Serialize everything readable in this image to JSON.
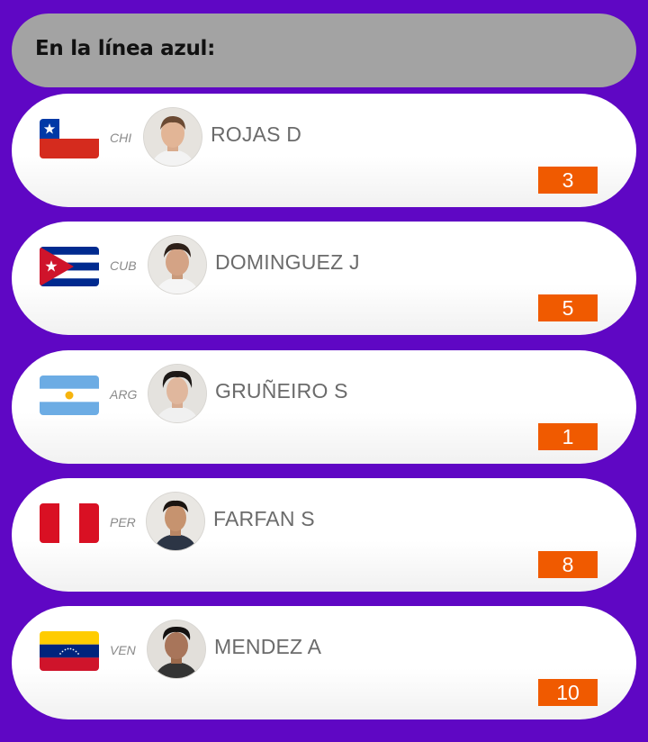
{
  "header": {
    "title": "En la línea azul:"
  },
  "players": [
    {
      "code": "CHI",
      "name": "ROJAS D",
      "score": "3",
      "flag": "chile-flag-icon"
    },
    {
      "code": "CUB",
      "name": "DOMINGUEZ J",
      "score": "5",
      "flag": "cuba-flag-icon"
    },
    {
      "code": "ARG",
      "name": "GRUÑEIRO S",
      "score": "1",
      "flag": "argentina-flag-icon"
    },
    {
      "code": "PER",
      "name": "FARFAN S",
      "score": "8",
      "flag": "peru-flag-icon"
    },
    {
      "code": "VEN",
      "name": "MENDEZ A",
      "score": "10",
      "flag": "venezuela-flag-icon"
    }
  ],
  "colors": {
    "background": "#5f07c4",
    "header": "#a3a3a3",
    "score_badge": "#f05a00",
    "name_text": "#6b6b6b"
  }
}
